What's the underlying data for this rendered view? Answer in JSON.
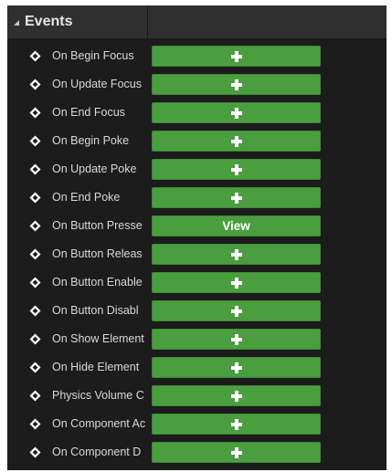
{
  "section": {
    "title": "Events",
    "collapse_icon": "collapse-arrow-icon"
  },
  "colors": {
    "panel_background": "#1c1c1c",
    "header_background": "#2f2f2f",
    "button_green": "#4a9e3f",
    "label_text": "#d8d8d8"
  },
  "events": [
    {
      "label": "On Begin Focus",
      "button": "add",
      "button_label": ""
    },
    {
      "label": "On Update Focus",
      "button": "add",
      "button_label": ""
    },
    {
      "label": "On End Focus",
      "button": "add",
      "button_label": ""
    },
    {
      "label": "On Begin Poke",
      "button": "add",
      "button_label": ""
    },
    {
      "label": "On Update Poke",
      "button": "add",
      "button_label": ""
    },
    {
      "label": "On End Poke",
      "button": "add",
      "button_label": ""
    },
    {
      "label": "On Button Presse",
      "button": "view",
      "button_label": "View"
    },
    {
      "label": "On Button Releas",
      "button": "add",
      "button_label": ""
    },
    {
      "label": "On Button Enable",
      "button": "add",
      "button_label": ""
    },
    {
      "label": "On Button Disabl",
      "button": "add",
      "button_label": ""
    },
    {
      "label": "On Show Element",
      "button": "add",
      "button_label": ""
    },
    {
      "label": "On Hide Element",
      "button": "add",
      "button_label": ""
    },
    {
      "label": "Physics Volume C",
      "button": "add",
      "button_label": ""
    },
    {
      "label": "On Component Ac",
      "button": "add",
      "button_label": ""
    },
    {
      "label": "On Component D",
      "button": "add",
      "button_label": ""
    }
  ]
}
